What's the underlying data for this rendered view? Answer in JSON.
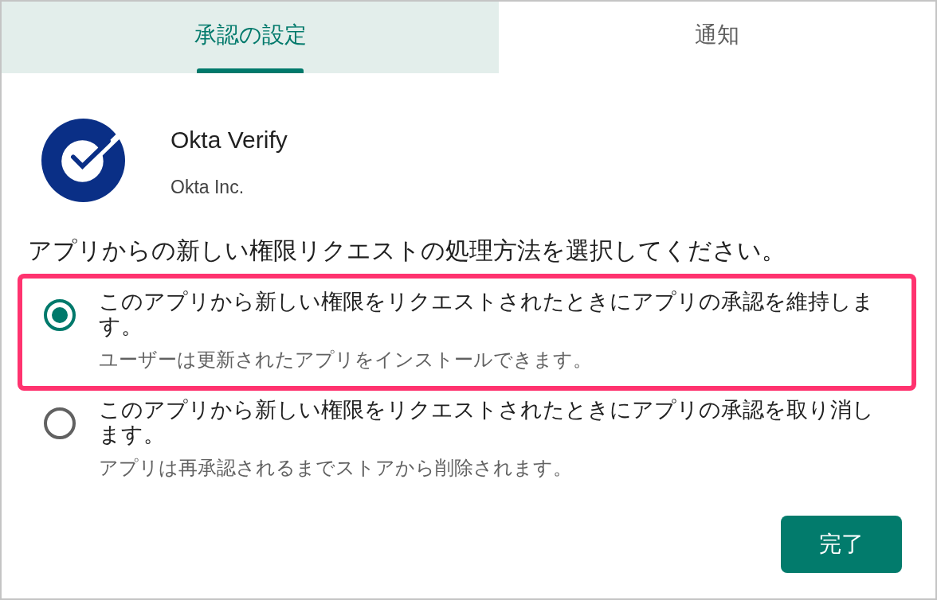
{
  "tabs": [
    {
      "label": "承認の設定",
      "selected": true
    },
    {
      "label": "通知",
      "selected": false
    }
  ],
  "app": {
    "name": "Okta Verify",
    "developer": "Okta Inc."
  },
  "prompt": "アプリからの新しい権限リクエストの処理方法を選択してください。",
  "options": [
    {
      "label": "このアプリから新しい権限をリクエストされたときにアプリの承認を維持します。",
      "description": "ユーザーは更新されたアプリをインストールできます。",
      "selected": true,
      "highlighted": true
    },
    {
      "label": "このアプリから新しい権限をリクエストされたときにアプリの承認を取り消します。",
      "description": "アプリは再承認されるまでストアから削除されます。",
      "selected": false,
      "highlighted": false
    }
  ],
  "done_button": {
    "label": "完了"
  }
}
